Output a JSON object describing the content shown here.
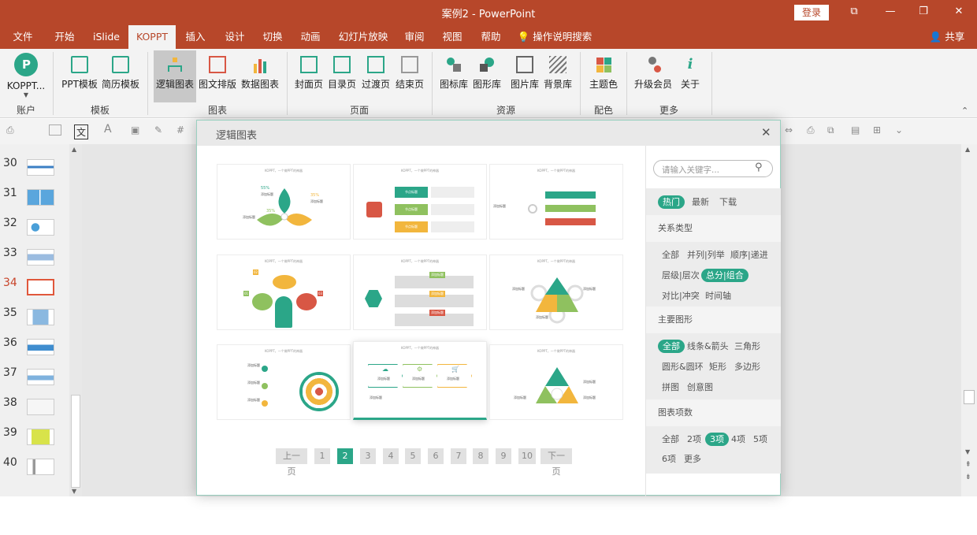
{
  "window": {
    "title": "案例2 - PowerPoint",
    "login_label": "登录",
    "share_label": "共享"
  },
  "menu": {
    "tabs": [
      "文件",
      "开始",
      "iSlide",
      "KOPPT",
      "插入",
      "设计",
      "切换",
      "动画",
      "幻灯片放映",
      "审阅",
      "视图",
      "帮助"
    ],
    "active_tab": "KOPPT",
    "tell_me": "操作说明搜索"
  },
  "ribbon": {
    "account": {
      "label": "KOPPT...",
      "group": "账户"
    },
    "template_group": {
      "group": "模板",
      "buttons": [
        "PPT模板",
        "简历模板"
      ]
    },
    "chart_group": {
      "group": "图表",
      "buttons": [
        "逻辑图表",
        "图文排版",
        "数据图表"
      ]
    },
    "page_group": {
      "group": "页面",
      "buttons": [
        "封面页",
        "目录页",
        "过渡页",
        "结束页"
      ]
    },
    "resource_group": {
      "group": "资源",
      "buttons": [
        "图标库",
        "图形库",
        "图片库",
        "背景库"
      ]
    },
    "color_group": {
      "group": "配色",
      "buttons": [
        "主题色"
      ]
    },
    "more_group": {
      "group": "更多",
      "buttons": [
        "升级会员",
        "关于"
      ]
    }
  },
  "slides": {
    "numbers": [
      "30",
      "31",
      "32",
      "33",
      "34",
      "35",
      "36",
      "37",
      "38",
      "39",
      "40"
    ],
    "current": "34"
  },
  "dialog": {
    "title": "逻辑图表",
    "card_caption": "KOPPT，一个做PPT的神器",
    "cards": [
      {
        "id": 1,
        "labels": [
          "55%",
          "35%",
          "35%",
          "添加标题",
          "添加标题",
          "添加标题"
        ]
      },
      {
        "id": 2,
        "labels": [
          "节点标题",
          "节点标题",
          "节点标题"
        ]
      },
      {
        "id": 3,
        "labels": [
          "添加标题"
        ]
      },
      {
        "id": 4,
        "labels": [
          "01",
          "02",
          "03"
        ]
      },
      {
        "id": 5,
        "labels": [
          "添加标题",
          "添加标题",
          "添加标题"
        ]
      },
      {
        "id": 6,
        "labels": [
          "添加标题",
          "添加标题",
          "添加标题"
        ]
      },
      {
        "id": 7,
        "labels": [
          "添加标题",
          "添加标题",
          "添加标题"
        ]
      },
      {
        "id": 8,
        "labels": [
          "添加标题",
          "添加标题",
          "添加标题",
          "添加标题"
        ]
      },
      {
        "id": 9,
        "labels": [
          "添加标题",
          "添加标题",
          "添加标题"
        ]
      }
    ],
    "pager": {
      "prev": "上一页",
      "next": "下一页",
      "pages": [
        "1",
        "2",
        "3",
        "4",
        "5",
        "6",
        "7",
        "8",
        "9",
        "10"
      ],
      "current": "2"
    },
    "filters": {
      "search_placeholder": "请输入关键字...",
      "sort_tabs": [
        "热门",
        "最新",
        "下载"
      ],
      "sort_active": "热门",
      "relation_title": "关系类型",
      "relation_items": [
        "全部",
        "并列|列举",
        "顺序|递进",
        "层级|层次",
        "总分|组合",
        "对比|冲突",
        "时间轴"
      ],
      "relation_active": "总分|组合",
      "shape_title": "主要图形",
      "shape_items": [
        "全部",
        "线条&箭头",
        "三角形",
        "圆形&圆环",
        "矩形",
        "多边形",
        "拼图",
        "创意图"
      ],
      "shape_active": "全部",
      "count_title": "图表项数",
      "count_items": [
        "全部",
        "2项",
        "3项",
        "4项",
        "5项",
        "6项",
        "更多"
      ],
      "count_active": "3项"
    }
  },
  "colors": {
    "accent": "#b7472a",
    "teal": "#2ba688",
    "yellow": "#f2b63d",
    "green": "#8fc15f",
    "red": "#d85745"
  }
}
